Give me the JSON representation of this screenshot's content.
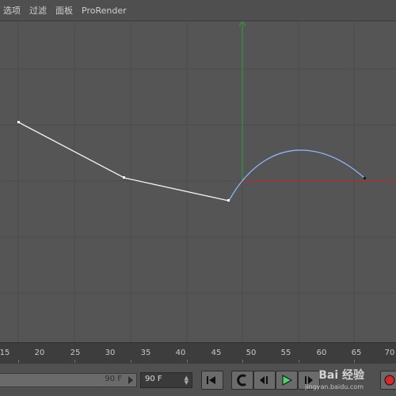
{
  "menu": [
    {
      "label": "选项"
    },
    {
      "label": "过滤"
    },
    {
      "label": "面板"
    },
    {
      "label": "ProRender"
    }
  ],
  "colors": {
    "background": "#555555",
    "grid": "#4a4a4a",
    "linear_curve": "#f2f2f2",
    "spline_curve": "#8fb4ff",
    "axis_x": "#c0262b",
    "axis_y": "#2ea043"
  },
  "ruler": {
    "labels": [
      "15",
      "20",
      "25",
      "30",
      "35",
      "40",
      "45",
      "50",
      "55",
      "60",
      "65",
      "70"
    ]
  },
  "controls": {
    "frame_slider_value": "90 F",
    "frame_field_value": "90 F",
    "buttons": [
      {
        "name": "go-to-start-icon"
      },
      {
        "name": "step-back-icon"
      },
      {
        "name": "play-backward-icon"
      },
      {
        "name": "play-forward-icon"
      },
      {
        "name": "step-forward-icon"
      },
      {
        "name": "record-icon"
      }
    ]
  },
  "watermark": {
    "text": "Bai 经验",
    "sub": "jingyan.baidu.com"
  }
}
